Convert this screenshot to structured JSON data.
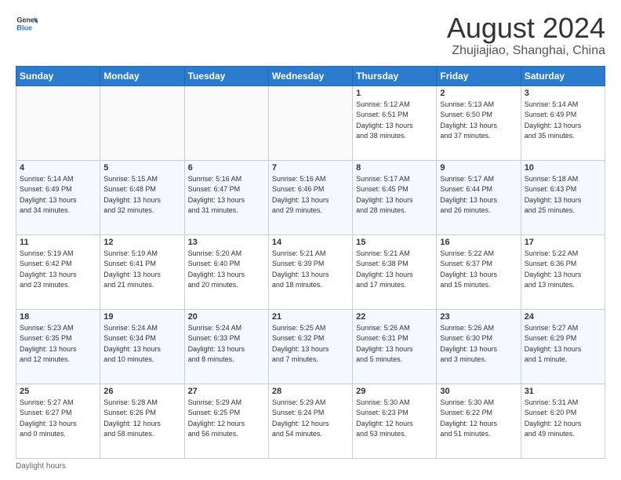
{
  "header": {
    "logo_line1": "General",
    "logo_line2": "Blue",
    "main_title": "August 2024",
    "subtitle": "Zhujiajiao, Shanghai, China"
  },
  "days_of_week": [
    "Sunday",
    "Monday",
    "Tuesday",
    "Wednesday",
    "Thursday",
    "Friday",
    "Saturday"
  ],
  "weeks": [
    [
      {
        "day": "",
        "info": ""
      },
      {
        "day": "",
        "info": ""
      },
      {
        "day": "",
        "info": ""
      },
      {
        "day": "",
        "info": ""
      },
      {
        "day": "1",
        "info": "Sunrise: 5:12 AM\nSunset: 6:51 PM\nDaylight: 13 hours\nand 38 minutes."
      },
      {
        "day": "2",
        "info": "Sunrise: 5:13 AM\nSunset: 6:50 PM\nDaylight: 13 hours\nand 37 minutes."
      },
      {
        "day": "3",
        "info": "Sunrise: 5:14 AM\nSunset: 6:49 PM\nDaylight: 13 hours\nand 35 minutes."
      }
    ],
    [
      {
        "day": "4",
        "info": "Sunrise: 5:14 AM\nSunset: 6:49 PM\nDaylight: 13 hours\nand 34 minutes."
      },
      {
        "day": "5",
        "info": "Sunrise: 5:15 AM\nSunset: 6:48 PM\nDaylight: 13 hours\nand 32 minutes."
      },
      {
        "day": "6",
        "info": "Sunrise: 5:16 AM\nSunset: 6:47 PM\nDaylight: 13 hours\nand 31 minutes."
      },
      {
        "day": "7",
        "info": "Sunrise: 5:16 AM\nSunset: 6:46 PM\nDaylight: 13 hours\nand 29 minutes."
      },
      {
        "day": "8",
        "info": "Sunrise: 5:17 AM\nSunset: 6:45 PM\nDaylight: 13 hours\nand 28 minutes."
      },
      {
        "day": "9",
        "info": "Sunrise: 5:17 AM\nSunset: 6:44 PM\nDaylight: 13 hours\nand 26 minutes."
      },
      {
        "day": "10",
        "info": "Sunrise: 5:18 AM\nSunset: 6:43 PM\nDaylight: 13 hours\nand 25 minutes."
      }
    ],
    [
      {
        "day": "11",
        "info": "Sunrise: 5:19 AM\nSunset: 6:42 PM\nDaylight: 13 hours\nand 23 minutes."
      },
      {
        "day": "12",
        "info": "Sunrise: 5:19 AM\nSunset: 6:41 PM\nDaylight: 13 hours\nand 21 minutes."
      },
      {
        "day": "13",
        "info": "Sunrise: 5:20 AM\nSunset: 6:40 PM\nDaylight: 13 hours\nand 20 minutes."
      },
      {
        "day": "14",
        "info": "Sunrise: 5:21 AM\nSunset: 6:39 PM\nDaylight: 13 hours\nand 18 minutes."
      },
      {
        "day": "15",
        "info": "Sunrise: 5:21 AM\nSunset: 6:38 PM\nDaylight: 13 hours\nand 17 minutes."
      },
      {
        "day": "16",
        "info": "Sunrise: 5:22 AM\nSunset: 6:37 PM\nDaylight: 13 hours\nand 15 minutes."
      },
      {
        "day": "17",
        "info": "Sunrise: 5:22 AM\nSunset: 6:36 PM\nDaylight: 13 hours\nand 13 minutes."
      }
    ],
    [
      {
        "day": "18",
        "info": "Sunrise: 5:23 AM\nSunset: 6:35 PM\nDaylight: 13 hours\nand 12 minutes."
      },
      {
        "day": "19",
        "info": "Sunrise: 5:24 AM\nSunset: 6:34 PM\nDaylight: 13 hours\nand 10 minutes."
      },
      {
        "day": "20",
        "info": "Sunrise: 5:24 AM\nSunset: 6:33 PM\nDaylight: 13 hours\nand 8 minutes."
      },
      {
        "day": "21",
        "info": "Sunrise: 5:25 AM\nSunset: 6:32 PM\nDaylight: 13 hours\nand 7 minutes."
      },
      {
        "day": "22",
        "info": "Sunrise: 5:26 AM\nSunset: 6:31 PM\nDaylight: 13 hours\nand 5 minutes."
      },
      {
        "day": "23",
        "info": "Sunrise: 5:26 AM\nSunset: 6:30 PM\nDaylight: 13 hours\nand 3 minutes."
      },
      {
        "day": "24",
        "info": "Sunrise: 5:27 AM\nSunset: 6:29 PM\nDaylight: 13 hours\nand 1 minute."
      }
    ],
    [
      {
        "day": "25",
        "info": "Sunrise: 5:27 AM\nSunset: 6:27 PM\nDaylight: 13 hours\nand 0 minutes."
      },
      {
        "day": "26",
        "info": "Sunrise: 5:28 AM\nSunset: 6:26 PM\nDaylight: 12 hours\nand 58 minutes."
      },
      {
        "day": "27",
        "info": "Sunrise: 5:29 AM\nSunset: 6:25 PM\nDaylight: 12 hours\nand 56 minutes."
      },
      {
        "day": "28",
        "info": "Sunrise: 5:29 AM\nSunset: 6:24 PM\nDaylight: 12 hours\nand 54 minutes."
      },
      {
        "day": "29",
        "info": "Sunrise: 5:30 AM\nSunset: 6:23 PM\nDaylight: 12 hours\nand 53 minutes."
      },
      {
        "day": "30",
        "info": "Sunrise: 5:30 AM\nSunset: 6:22 PM\nDaylight: 12 hours\nand 51 minutes."
      },
      {
        "day": "31",
        "info": "Sunrise: 5:31 AM\nSunset: 6:20 PM\nDaylight: 12 hours\nand 49 minutes."
      }
    ]
  ],
  "footer": {
    "label": "Daylight hours"
  }
}
